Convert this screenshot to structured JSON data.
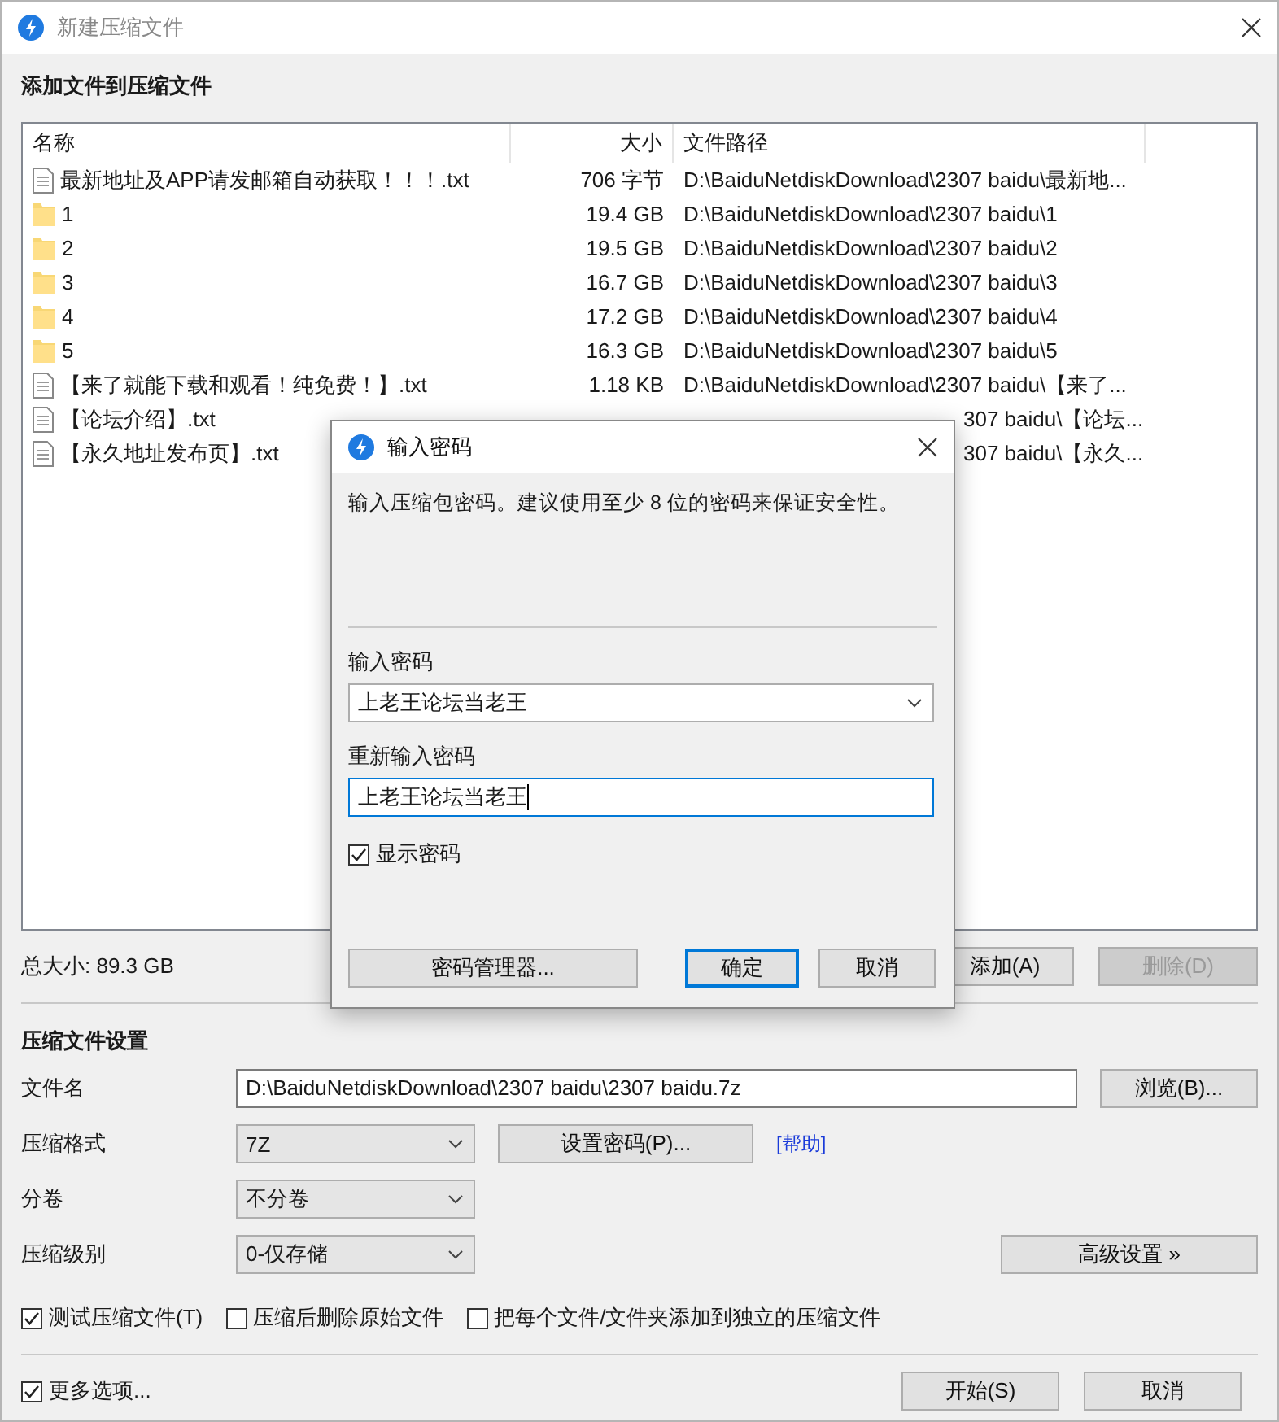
{
  "window": {
    "title": "新建压缩文件"
  },
  "files": {
    "heading": "添加文件到压缩文件",
    "columns": [
      "名称",
      "大小",
      "文件路径"
    ],
    "rows": [
      {
        "kind": "file",
        "name": "最新地址及APP请发邮箱自动获取！！！.txt",
        "size": "706 字节",
        "path": "D:\\BaiduNetdiskDownload\\2307 baidu\\最新地...",
        "clipped": false
      },
      {
        "kind": "folder",
        "name": "1",
        "size": "19.4 GB",
        "path": "D:\\BaiduNetdiskDownload\\2307 baidu\\1",
        "clipped": false
      },
      {
        "kind": "folder",
        "name": "2",
        "size": "19.5 GB",
        "path": "D:\\BaiduNetdiskDownload\\2307 baidu\\2",
        "clipped": false
      },
      {
        "kind": "folder",
        "name": "3",
        "size": "16.7 GB",
        "path": "D:\\BaiduNetdiskDownload\\2307 baidu\\3",
        "clipped": false
      },
      {
        "kind": "folder",
        "name": "4",
        "size": "17.2 GB",
        "path": "D:\\BaiduNetdiskDownload\\2307 baidu\\4",
        "clipped": false
      },
      {
        "kind": "folder",
        "name": "5",
        "size": "16.3 GB",
        "path": "D:\\BaiduNetdiskDownload\\2307 baidu\\5",
        "clipped": false
      },
      {
        "kind": "file",
        "name": "【来了就能下载和观看！纯免费！】.txt",
        "size": "1.18 KB",
        "path": "D:\\BaiduNetdiskDownload\\2307 baidu\\【来了...",
        "clipped": false
      },
      {
        "kind": "file",
        "name": "【论坛介绍】.txt",
        "path": "307 baidu\\【论坛...",
        "clipped": true
      },
      {
        "kind": "file",
        "name": "【永久地址发布页】.txt",
        "path": "307 baidu\\【永久...",
        "clipped": true
      }
    ],
    "total": "总大小: 89.3 GB",
    "buttons": [
      {
        "label": "添加(A)",
        "disabled": false
      },
      {
        "label": "删除(D)",
        "disabled": true
      }
    ]
  },
  "settings": {
    "heading": "压缩文件设置",
    "filename": {
      "label": "文件名",
      "value": "D:\\BaiduNetdiskDownload\\2307 baidu\\2307 baidu.7z",
      "button": "浏览(B)..."
    },
    "format": {
      "label": "压缩格式",
      "value": "7Z"
    },
    "password_button": "设置密码(P)...",
    "help_link": "[帮助]",
    "split": {
      "label": "分卷",
      "value": "不分卷"
    },
    "level": {
      "label": "压缩级别",
      "value": "0-仅存储"
    },
    "advanced_button": "高级设置 »",
    "options": [
      {
        "label": "测试压缩文件(T)",
        "checked": true
      },
      {
        "label": "压缩后删除原始文件",
        "checked": false
      },
      {
        "label": "把每个文件/文件夹添加到独立的压缩文件",
        "checked": false
      }
    ]
  },
  "footer": {
    "more_options": {
      "label": "更多选项...",
      "checked": true
    },
    "buttons": [
      "开始(S)",
      "取消"
    ]
  },
  "dialog": {
    "title": "输入密码",
    "message": "输入压缩包密码。建议使用至少 8 位的密码来保证安全性。",
    "password_label": "输入密码",
    "password": "上老王论坛当老王",
    "confirm_label": "重新输入密码",
    "confirm": "上老王论坛当老王",
    "show_password": {
      "label": "显示密码",
      "checked": true
    },
    "buttons": [
      {
        "label": "密码管理器...",
        "default": false
      },
      {
        "label": "确定",
        "default": true
      },
      {
        "label": "取消",
        "default": false
      }
    ]
  }
}
